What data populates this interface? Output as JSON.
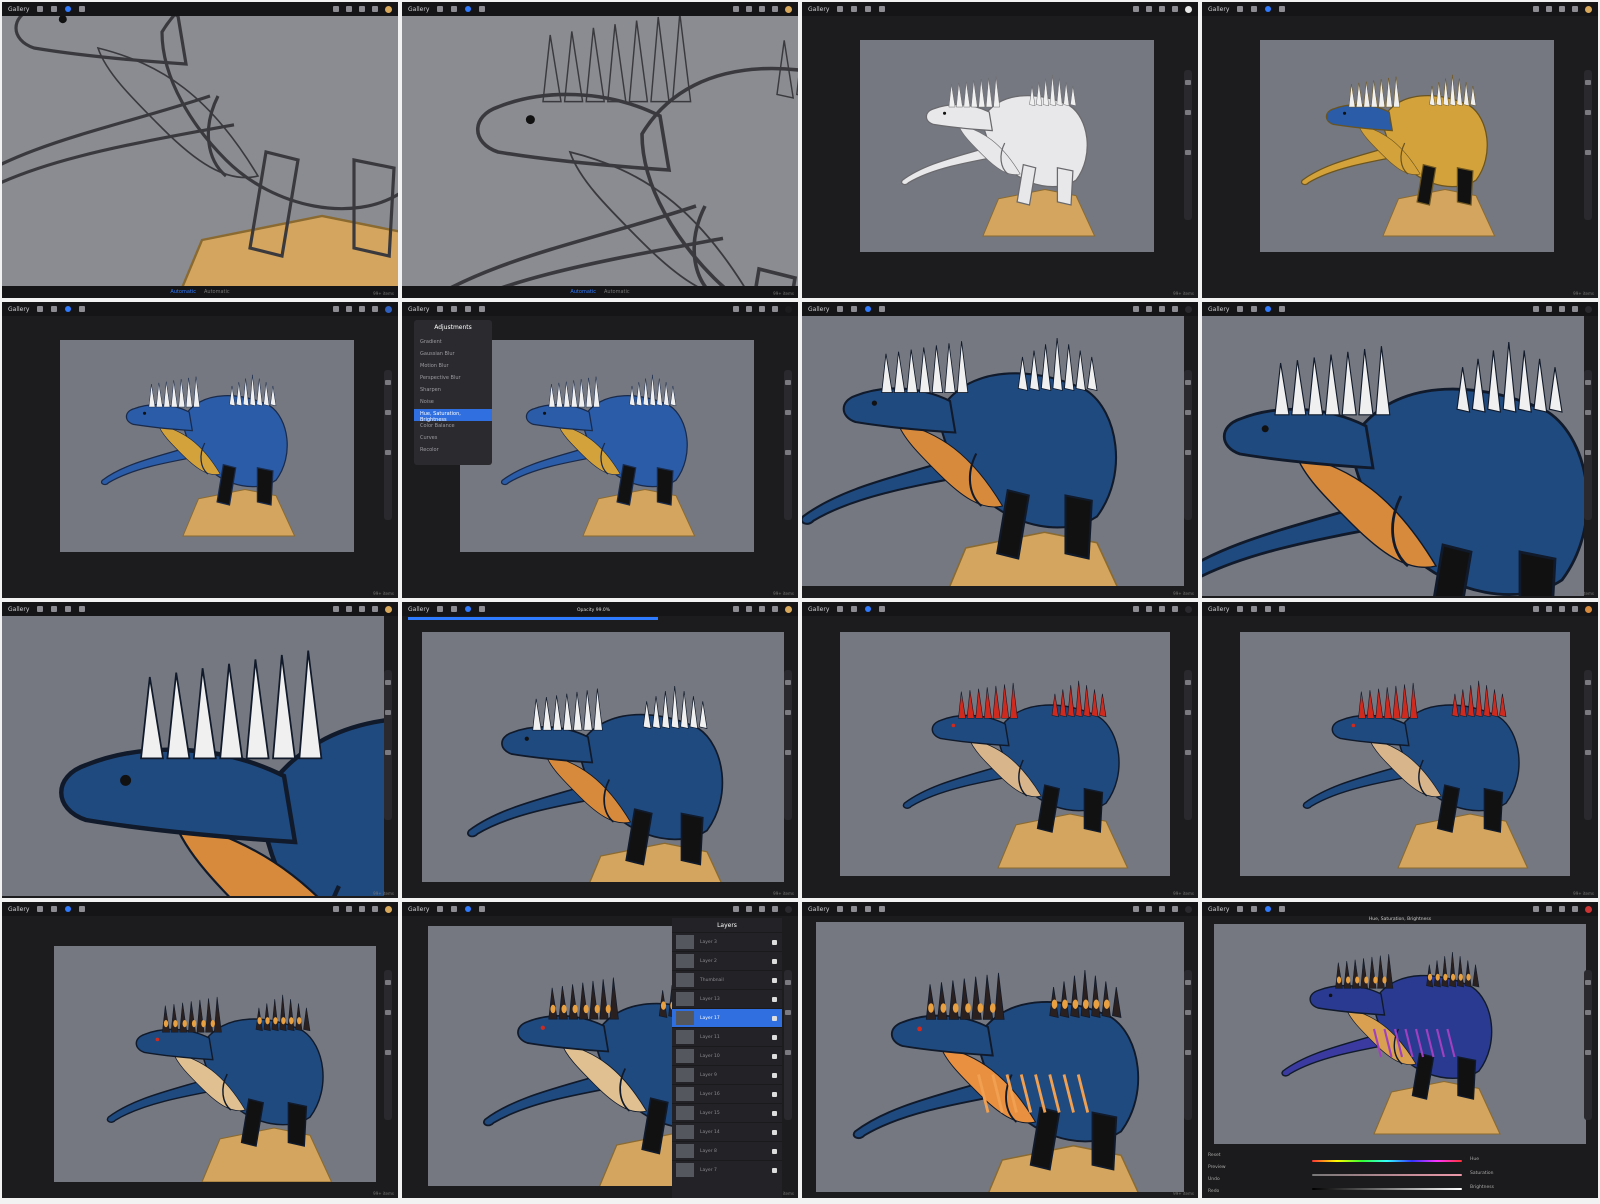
{
  "ui": {
    "gallery_label": "Gallery",
    "accent_color": "#2f7bff",
    "swatch_colors": [
      "#d9a85a",
      "#d9a85a",
      "#e8e8e8",
      "#d9a85a",
      "#2f5fbf",
      "#1c1c1e",
      "#2a2a2e",
      "#2a2a2e",
      "#d9a85a",
      "#d9a85a",
      "#2a2a2e",
      "#d88a3c",
      "#d9a85a",
      "#2a2a2e",
      "#2a2a2e",
      "#cc3333"
    ]
  },
  "panels": [
    {
      "id": "p1",
      "view": "pencil sketch with sand rock",
      "bottom_text": [
        "Automatic",
        "Automatic"
      ]
    },
    {
      "id": "p2",
      "view": "closeup wing sketch",
      "bottom_text": [
        "Automatic",
        "Automatic"
      ]
    },
    {
      "id": "p3",
      "view": "white line drawing"
    },
    {
      "id": "p4",
      "view": "yellow base color"
    },
    {
      "id": "p5",
      "view": "blue base color"
    },
    {
      "id": "p6",
      "view": "adjustments menu"
    },
    {
      "id": "p7",
      "view": "zoomed shaded"
    },
    {
      "id": "p8",
      "view": "zoomed head"
    },
    {
      "id": "p9",
      "view": "closeup head with red eye"
    },
    {
      "id": "p10",
      "view": "opacity adjust"
    },
    {
      "id": "p11",
      "view": "red spikes"
    },
    {
      "id": "p12",
      "view": "red spikes"
    },
    {
      "id": "p13",
      "view": "orange spots"
    },
    {
      "id": "p14",
      "view": "layers panel"
    },
    {
      "id": "p15",
      "view": "orange streaks"
    },
    {
      "id": "p16",
      "view": "hue saturation brightness"
    }
  ],
  "adjustments": {
    "title": "Adjustments",
    "items": [
      "Gradient",
      "Gaussian Blur",
      "Motion Blur",
      "Perspective Blur",
      "Sharpen",
      "Noise",
      "Hue, Saturation, Brightness",
      "Color Balance",
      "Curves",
      "Recolor"
    ],
    "selected_index": 6
  },
  "opacity_label": "Opacity 99.0%",
  "layers": {
    "title": "Layers",
    "items": [
      "Layer 3",
      "Layer 2",
      "Thumbnail",
      "Layer 13",
      "Layer 17",
      "Layer 11",
      "Layer 10",
      "Layer 9",
      "Layer 16",
      "Layer 15",
      "Layer 14",
      "Layer 8",
      "Layer 7"
    ],
    "selected_index": 4
  },
  "hsb": {
    "title": "Hue, Saturation, Brightness",
    "side_items": [
      "Reset",
      "Preview",
      "Undo",
      "Redo"
    ],
    "slider_labels": [
      "Hue",
      "Saturation",
      "Brightness"
    ],
    "values": [
      0.5,
      0.5,
      0.5
    ]
  },
  "watermark": "99+ items"
}
